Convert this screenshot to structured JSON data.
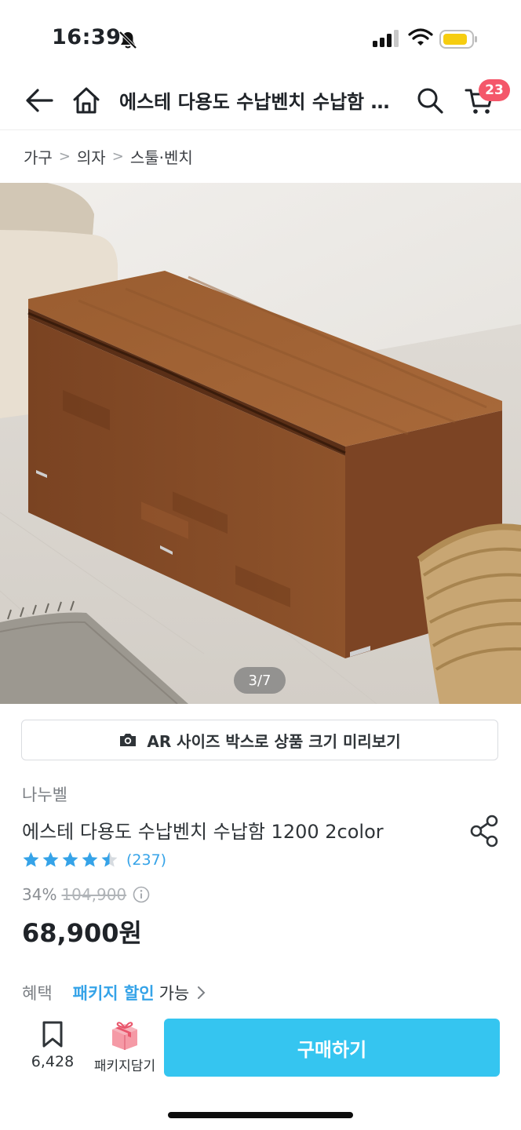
{
  "status_bar": {
    "time": "16:39"
  },
  "nav": {
    "title": "에스테 다용도 수납벤치 수납함 1200 2color",
    "cart_count": "23"
  },
  "breadcrumb": [
    "가구",
    "의자",
    "스툴·벤치"
  ],
  "image": {
    "counter": "3/7"
  },
  "ar_button": {
    "label": "AR 사이즈 박스로 상품 크기 미리보기"
  },
  "product": {
    "brand": "나누벨",
    "name": "에스테 다용도 수납벤치 수납함 1200 2color",
    "rating": 4.5,
    "review_count": "(237)",
    "discount": "34%",
    "original_price": "104,900",
    "price": "68,900원"
  },
  "benefit": {
    "label": "혜택",
    "link": "패키지 할인",
    "suffix": "가능"
  },
  "bottom_bar": {
    "bookmark_count": "6,428",
    "package_label": "패키지담기",
    "buy_label": "구매하기"
  },
  "colors": {
    "accent": "#35c5f0",
    "link": "#35a3e8",
    "badge": "#f4576a"
  },
  "icons": [
    "bell-slash-icon",
    "back-arrow-icon",
    "home-icon",
    "search-icon",
    "cart-icon",
    "camera-icon",
    "share-icon",
    "star-icon",
    "bookmark-icon",
    "package-box-icon",
    "chevron-right-icon",
    "info-icon"
  ]
}
